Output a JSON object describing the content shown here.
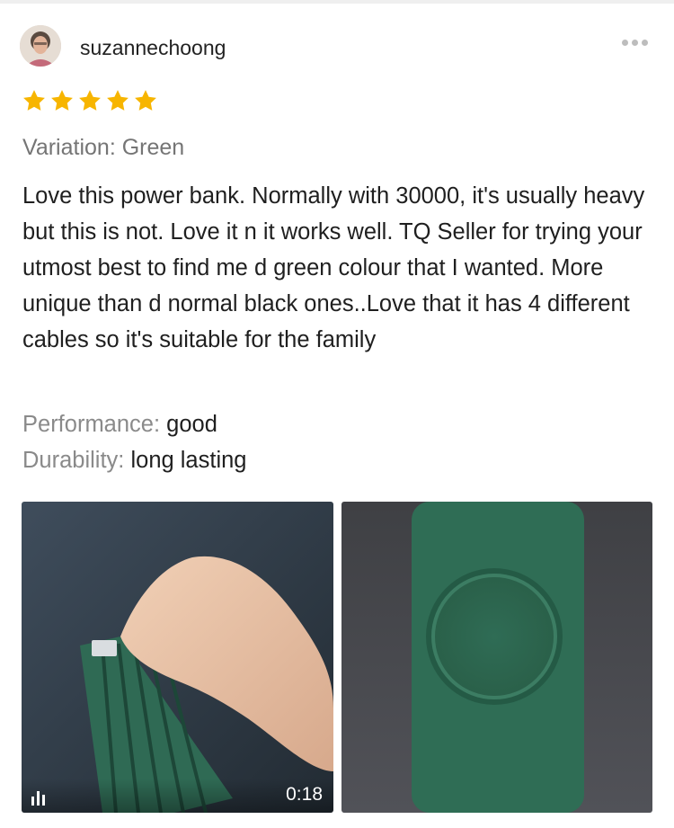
{
  "review": {
    "username": "suzannechoong",
    "rating": 5,
    "rating_max": 5,
    "variation": "Variation: Green",
    "text": "Love this power bank. Normally with 30000, it's usually heavy but this is not. Love it n it works well. TQ Seller for trying your utmost best to find me d green colour that I wanted. More unique than d normal black ones..Love that it has 4 different cables so it's suitable for the family",
    "attributes": [
      {
        "label": "Performance:",
        "value": "good"
      },
      {
        "label": "Durability:",
        "value": "long lasting"
      }
    ]
  },
  "media": [
    {
      "type": "video",
      "duration": "0:18",
      "icon": "video-bars-icon"
    },
    {
      "type": "image"
    }
  ],
  "icons": {
    "more": "more-dots-icon",
    "star": "star-icon"
  },
  "colors": {
    "star": "#f7b500",
    "secondary_text": "#8a8a8a",
    "product_green": "#2e6a52"
  }
}
